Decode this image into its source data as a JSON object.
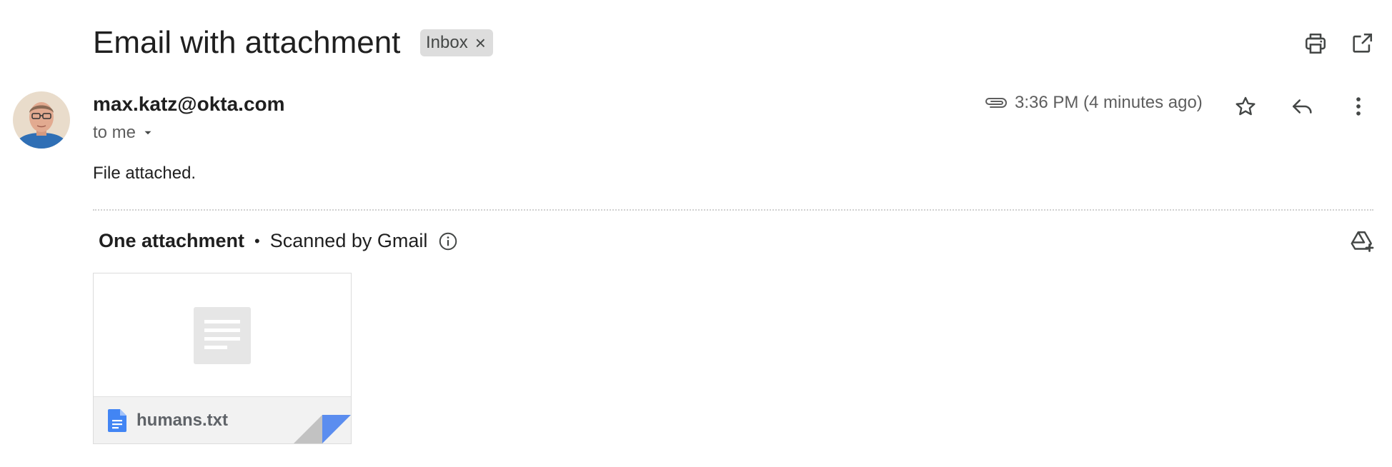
{
  "header": {
    "subject": "Email with attachment",
    "label_chip": "Inbox",
    "label_remove": "×",
    "print_icon": "print-icon",
    "open_new_window_icon": "open-in-new-icon"
  },
  "message": {
    "sender_email": "max.katz@okta.com",
    "recipient_label": "to me",
    "time": "3:36 PM (4 minutes ago)",
    "body": "File attached.",
    "icons": {
      "attachment": "paperclip-icon",
      "star": "star-icon",
      "reply": "reply-icon",
      "more": "more-vert-icon"
    }
  },
  "attachments": {
    "count_label": "One attachment",
    "separator": "•",
    "scan_label": "Scanned by Gmail",
    "info_icon": "info-icon",
    "add_to_drive_icon": "add-to-drive-icon",
    "files": [
      {
        "name": "humans.txt",
        "icon": "document-icon"
      }
    ]
  },
  "colors": {
    "doc_icon_blue": "#4285f4",
    "chip_bg": "#dddddd",
    "text_secondary": "#5e5e5e"
  }
}
